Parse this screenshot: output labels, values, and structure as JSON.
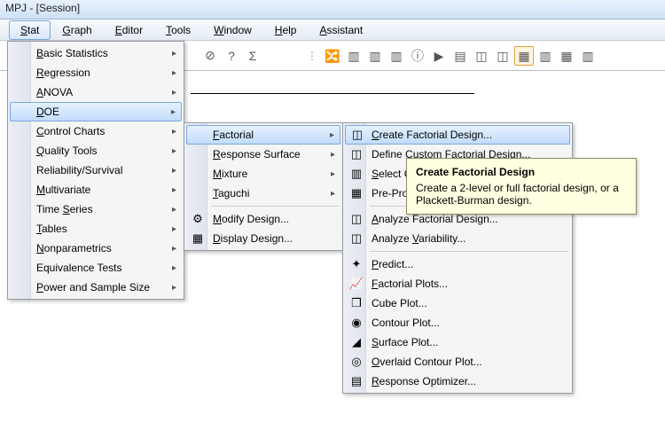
{
  "title": "MPJ - [Session]",
  "menubar": [
    "Stat",
    "Graph",
    "Editor",
    "Tools",
    "Window",
    "Help",
    "Assistant"
  ],
  "menubar_open": 0,
  "menu_stat": {
    "items": [
      {
        "label": "Basic Statistics",
        "sub": true
      },
      {
        "label": "Regression",
        "sub": true
      },
      {
        "label": "ANOVA",
        "sub": true
      },
      {
        "label": "DOE",
        "sub": true,
        "hl": true
      },
      {
        "label": "Control Charts",
        "sub": true
      },
      {
        "label": "Quality Tools",
        "sub": true
      },
      {
        "label": "Reliability/Survival",
        "sub": true
      },
      {
        "label": "Multivariate",
        "sub": true
      },
      {
        "label": "Time Series",
        "sub": true
      },
      {
        "label": "Tables",
        "sub": true
      },
      {
        "label": "Nonparametrics",
        "sub": true
      },
      {
        "label": "Equivalence Tests",
        "sub": true
      },
      {
        "label": "Power and Sample Size",
        "sub": true
      }
    ],
    "underline": [
      "B",
      "R",
      "A",
      "D",
      "C",
      "Q",
      "",
      "M",
      "S",
      "T",
      "N",
      "",
      "P"
    ]
  },
  "menu_doe": {
    "items": [
      {
        "label": "Factorial",
        "sub": true,
        "hl": true
      },
      {
        "label": "Response Surface",
        "sub": true
      },
      {
        "label": "Mixture",
        "sub": true
      },
      {
        "label": "Taguchi",
        "sub": true
      },
      {
        "sep": true
      },
      {
        "label": "Modify Design...",
        "icon": "⚙"
      },
      {
        "label": "Display Design...",
        "icon": "▦"
      }
    ],
    "underline": [
      "F",
      "R",
      "M",
      "T",
      "",
      "M",
      "D"
    ]
  },
  "menu_fact": {
    "items": [
      {
        "label": "Create Factorial Design...",
        "hl": true,
        "icon": "◫"
      },
      {
        "label": "Define Custom Factorial Design...",
        "icon": "◫"
      },
      {
        "label": "Select Optimal Design...",
        "icon": "▥"
      },
      {
        "label": "Pre-Process Responses for Analyze Variability...",
        "icon": "▦"
      },
      {
        "sep": true
      },
      {
        "label": "Analyze Factorial Design...",
        "icon": "◫"
      },
      {
        "label": "Analyze Variability...",
        "icon": "◫"
      },
      {
        "sep": true
      },
      {
        "label": "Predict...",
        "icon": "✦"
      },
      {
        "label": "Factorial Plots...",
        "icon": "📈"
      },
      {
        "label": "Cube Plot...",
        "icon": "❒"
      },
      {
        "label": "Contour Plot...",
        "icon": "◉"
      },
      {
        "label": "Surface Plot...",
        "icon": "◢"
      },
      {
        "label": "Overlaid Contour Plot...",
        "icon": "◎"
      },
      {
        "label": "Response Optimizer...",
        "icon": "▤"
      }
    ],
    "underline": [
      "C",
      "",
      "S",
      "",
      "",
      "A",
      "V",
      "",
      "P",
      "F",
      "",
      "",
      "S",
      "O",
      "R"
    ]
  },
  "tooltip": {
    "title": "Create Factorial Design",
    "body": "Create a 2-level or full factorial design, or a Plackett-Burman design."
  },
  "toolbar_left": [
    "⊘",
    "?",
    "Σ"
  ],
  "toolbar_right": [
    "🔀",
    "▥",
    "▥",
    "▥",
    "ⓘ",
    "▶",
    "▤",
    "◫",
    "◫",
    "▦",
    "▥",
    "▦",
    "▥"
  ]
}
